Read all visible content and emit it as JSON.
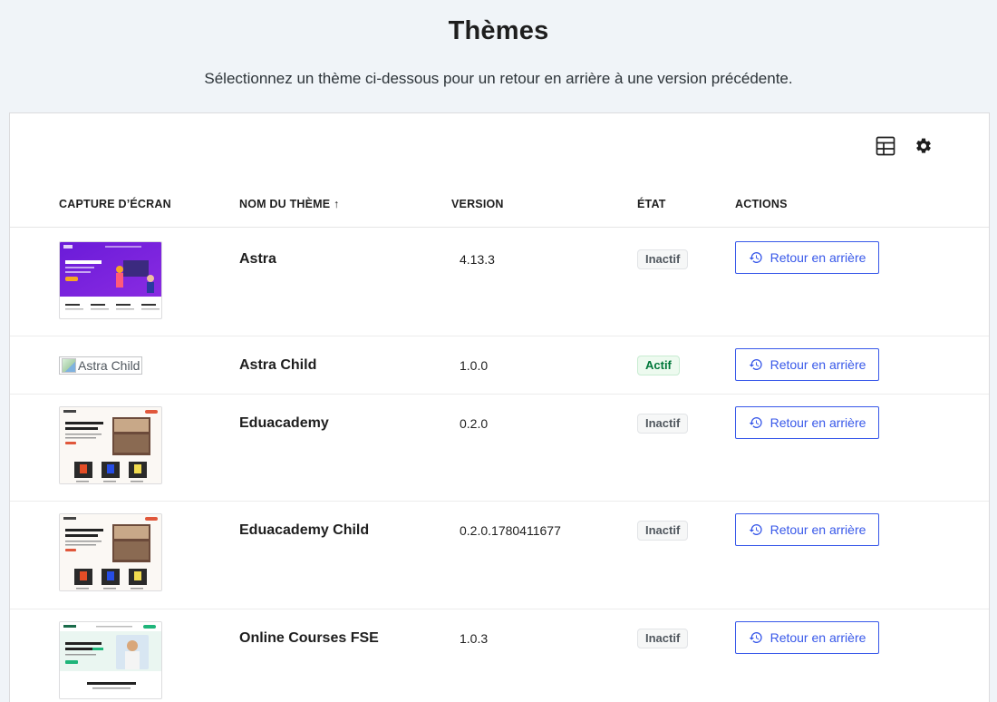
{
  "header": {
    "title": "Thèmes",
    "subtitle": "Sélectionnez un thème ci-dessous pour un retour en arrière à une version précédente."
  },
  "toolbar": {
    "icons": [
      "table-view-icon",
      "gear-icon"
    ]
  },
  "table": {
    "columns": {
      "screenshot": "CAPTURE D’ÉCRAN",
      "name": "NOM DU THÈME ↑",
      "version": "VERSION",
      "state": "ÉTAT",
      "actions": "ACTIONS"
    },
    "rows": [
      {
        "name": "Astra",
        "version": "4.13.3",
        "state": "Inactif",
        "action": "Retour en arrière"
      },
      {
        "name": "Astra Child",
        "version": "1.0.0",
        "state": "Actif",
        "action": "Retour en arrière",
        "alt": "Astra Child"
      },
      {
        "name": "Eduacademy",
        "version": "0.2.0",
        "state": "Inactif",
        "action": "Retour en arrière"
      },
      {
        "name": "Eduacademy Child",
        "version": "0.2.0.1780411677",
        "state": "Inactif",
        "action": "Retour en arrière"
      },
      {
        "name": "Online Courses FSE",
        "version": "1.0.3",
        "state": "Inactif",
        "action": "Retour en arrière"
      }
    ]
  },
  "colors": {
    "accent": "#3858e9",
    "active_badge": "#00783a",
    "page_bg": "#f0f4f8"
  }
}
